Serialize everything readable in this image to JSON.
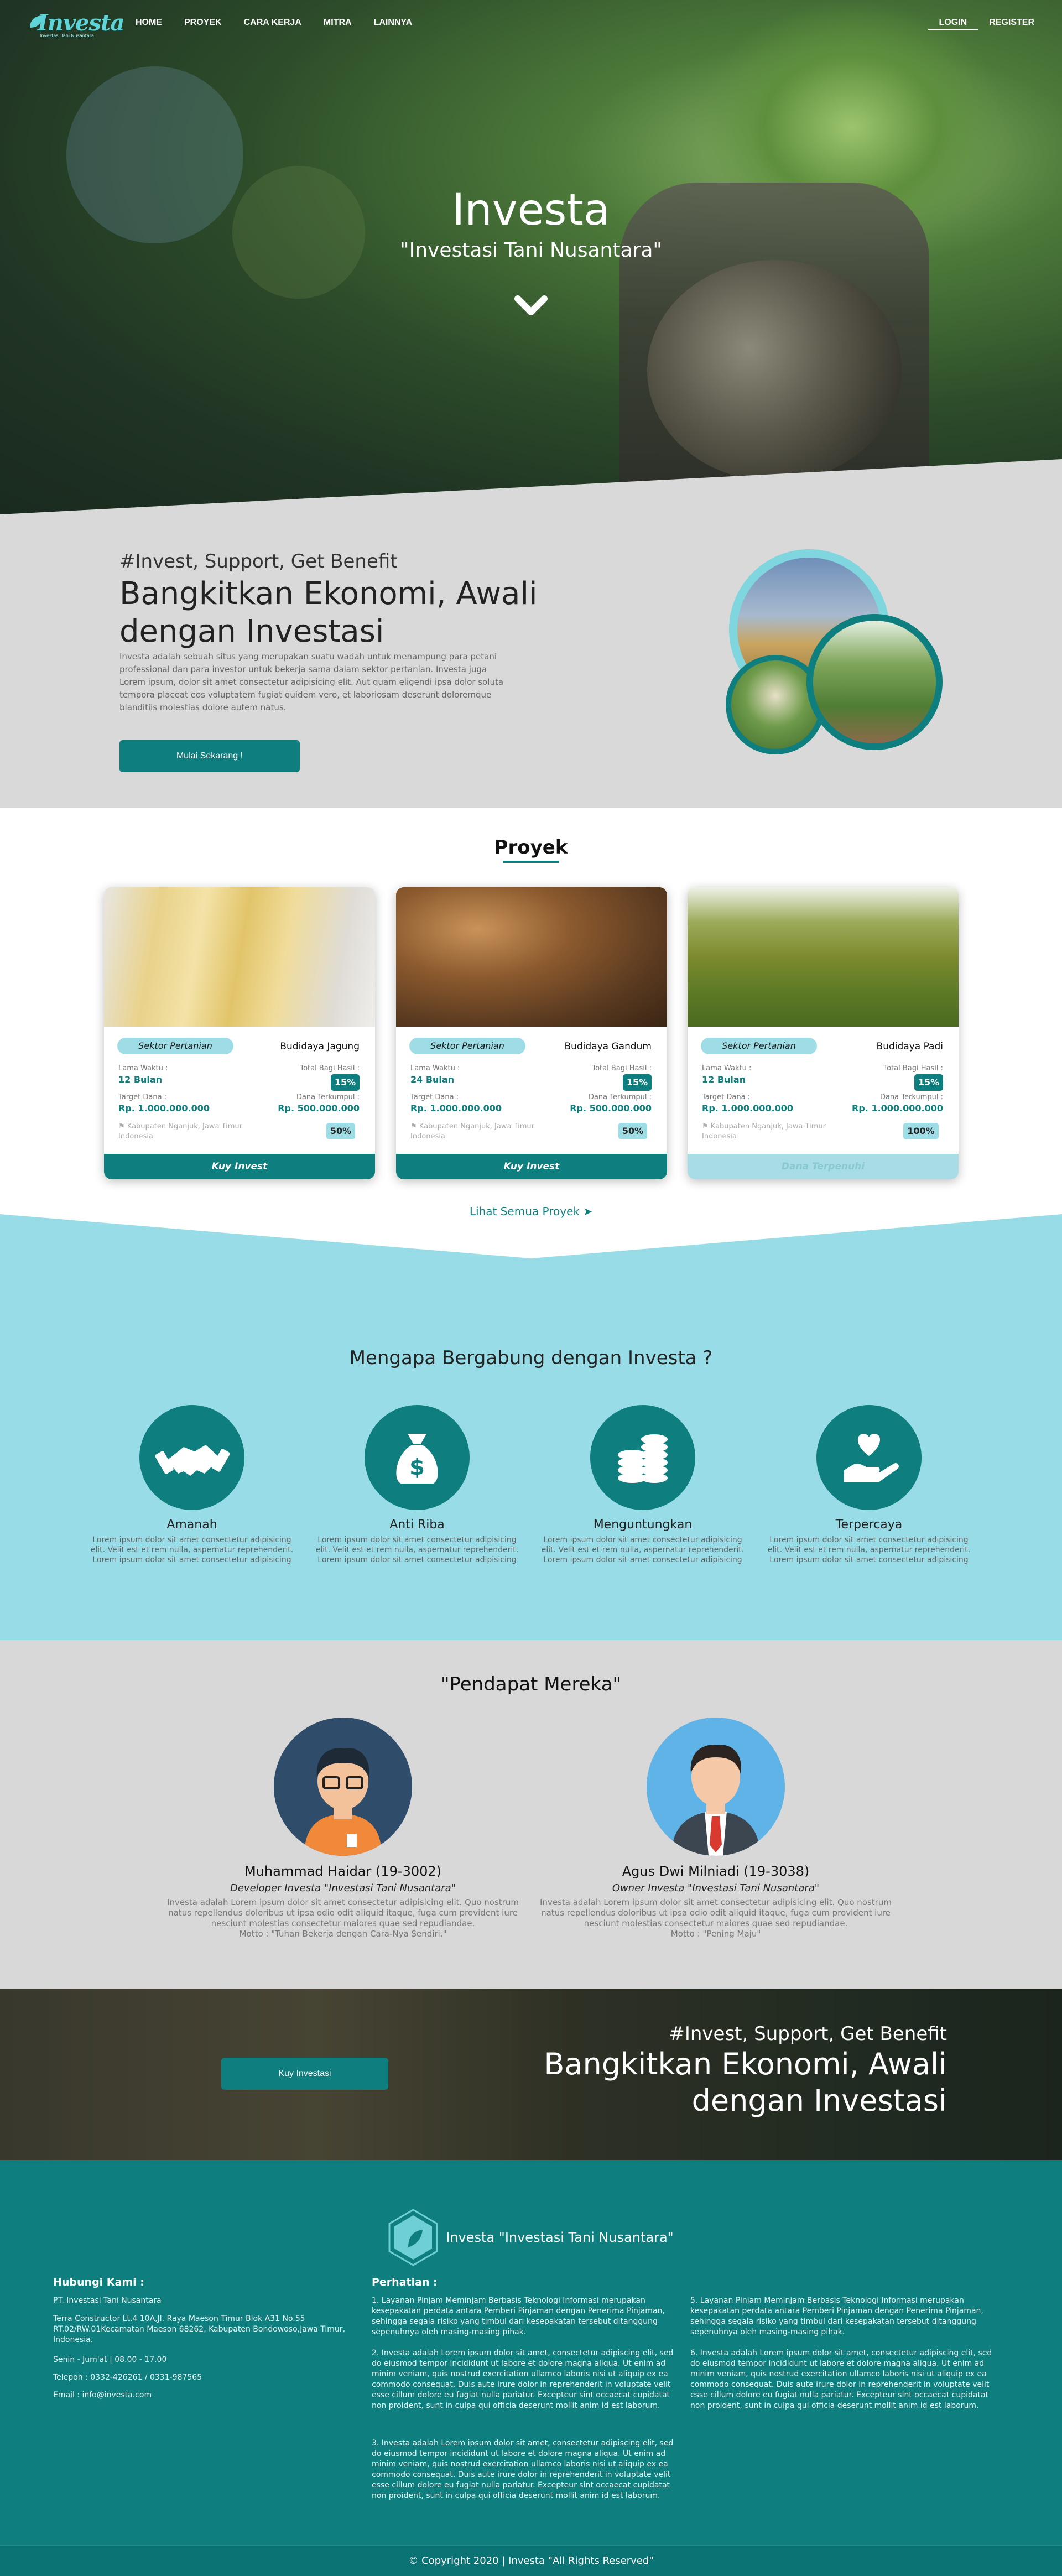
{
  "nav": {
    "logo_text": "Investa",
    "logo_sub": "Investasi Tani Nusantara",
    "links": [
      "HOME",
      "PROYEK",
      "CARA KERJA",
      "MITRA",
      "LAINNYA"
    ],
    "login": "LOGIN",
    "register": "REGISTER"
  },
  "hero": {
    "title": "Investa",
    "tagline": "\"Investasi Tani Nusantara\""
  },
  "about": {
    "hashtag": "#Invest, Support, Get Benefit",
    "heading": "Bangkitkan Ekonomi, Awali dengan Investasi",
    "body": "Investa adalah sebuah situs yang merupakan suatu wadah untuk menampung para petani professional dan para investor untuk bekerja sama dalam sektor pertanian. Investa juga Lorem ipsum, dolor sit amet consectetur adipisicing elit. Aut quam eligendi ipsa dolor soluta tempora placeat eos voluptatem fugiat quidem vero, et laboriosam deserunt doloremque blanditiis molestias dolore autem natus.",
    "cta": "Mulai Sekarang !"
  },
  "projects": {
    "title": "Proyek",
    "cards": [
      {
        "sector": "Sektor Pertanian",
        "name": "Budidaya Jagung",
        "lama_label": "Lama Waktu :",
        "lama": "12 Bulan",
        "bagi_label": "Total Bagi Hasil :",
        "bagi": "15%",
        "target_label": "Target Dana :",
        "target": "Rp. 1.000.000.000",
        "terkumpul_label": "Dana Terkumpul :",
        "terkumpul": "Rp. 500.000.000",
        "progress": "50%",
        "location": "Kabupaten Nganjuk, Jawa Timur Indonesia",
        "button": "Kuy Invest"
      },
      {
        "sector": "Sektor Pertanian",
        "name": "Budidaya Gandum",
        "lama_label": "Lama Waktu :",
        "lama": "24 Bulan",
        "bagi_label": "Total Bagi Hasil :",
        "bagi": "15%",
        "target_label": "Target Dana :",
        "target": "Rp. 1.000.000.000",
        "terkumpul_label": "Dana Terkumpul :",
        "terkumpul": "Rp. 500.000.000",
        "progress": "50%",
        "location": "Kabupaten Nganjuk, Jawa Timur Indonesia",
        "button": "Kuy Invest"
      },
      {
        "sector": "Sektor Pertanian",
        "name": "Budidaya Padi",
        "lama_label": "Lama Waktu :",
        "lama": "12 Bulan",
        "bagi_label": "Total Bagi Hasil :",
        "bagi": "15%",
        "target_label": "Target Dana :",
        "target": "Rp. 1.000.000.000",
        "terkumpul_label": "Dana Terkumpul :",
        "terkumpul": "Rp. 1.000.000.000",
        "progress": "100%",
        "location": "Kabupaten Nganjuk, Jawa Timur Indonesia",
        "button": "Dana Terpenuhi"
      }
    ],
    "all_link": "Lihat Semua Proyek"
  },
  "why": {
    "title": "Mengapa Bergabung dengan Investa ?",
    "features": [
      {
        "icon": "handshake-icon",
        "title": "Amanah",
        "desc": "Lorem ipsum dolor sit amet consectetur adipisicing elit. Velit est et rem nulla, aspernatur reprehenderit. Lorem ipsum dolor sit amet consectetur adipisicing"
      },
      {
        "icon": "money-bag-icon",
        "title": "Anti Riba",
        "desc": "Lorem ipsum dolor sit amet consectetur adipisicing elit. Velit est et rem nulla, aspernatur reprehenderit. Lorem ipsum dolor sit amet consectetur adipisicing"
      },
      {
        "icon": "coins-icon",
        "title": "Menguntungkan",
        "desc": "Lorem ipsum dolor sit amet consectetur adipisicing elit. Velit est et rem nulla, aspernatur reprehenderit. Lorem ipsum dolor sit amet consectetur adipisicing"
      },
      {
        "icon": "heart-hand-icon",
        "title": "Terpercaya",
        "desc": "Lorem ipsum dolor sit amet consectetur adipisicing elit. Velit est et rem nulla, aspernatur reprehenderit. Lorem ipsum dolor sit amet consectetur adipisicing"
      }
    ]
  },
  "testimonials": {
    "title": "\"Pendapat Mereka\"",
    "people": [
      {
        "name": "Muhammad Haidar (19-3002)",
        "role": "Developer Investa \"Investasi Tani Nusantara\"",
        "text": "Investa adalah Lorem ipsum dolor sit amet consectetur adipisicing elit. Quo nostrum natus repellendus doloribus ut ipsa odio odit aliquid itaque, fuga cum provident iure nesciunt molestias consectetur maiores quae sed repudiandae.",
        "motto": "Motto : \"Tuhan Bekerja dengan Cara-Nya Sendiri.\""
      },
      {
        "name": "Agus Dwi Milniadi (19-3038)",
        "role": "Owner Investa \"Investasi Tani Nusantara\"",
        "text": "Investa adalah Lorem ipsum dolor sit amet consectetur adipisicing elit. Quo nostrum natus repellendus doloribus ut ipsa odio odit aliquid itaque, fuga cum provident iure nesciunt molestias consectetur maiores quae sed repudiandae.",
        "motto": "Motto : \"Pening Maju\""
      }
    ]
  },
  "banner": {
    "hashtag": "#Invest, Support, Get Benefit",
    "heading": "Bangkitkan Ekonomi, Awali dengan Investasi",
    "cta": "Kuy Investasi"
  },
  "footer": {
    "brand": "Investa \"Investasi Tani Nusantara\"",
    "contact_title": "Hubungi Kami :",
    "company": "PT. Investasi Tani Nusantara",
    "address": "Terra Constructor Lt.4 10A,Jl. Raya Maeson Timur Blok A31 No.55 RT.02/RW.01Kecamatan Maeson 68262, Kabupaten Bondowoso,Jawa Timur, Indonesia.",
    "hours": "Senin - Jum'at | 08.00 - 17.00",
    "phone": "Telepon : 0332-426261 / 0331-987565",
    "email": "Email : info@investa.com",
    "notice_title": "Perhatian :",
    "notices": [
      "1. Layanan Pinjam Meminjam Berbasis Teknologi Informasi merupakan kesepakatan perdata antara Pemberi Pinjaman dengan Penerima Pinjaman, sehingga segala risiko yang timbul dari kesepakatan tersebut ditanggung sepenuhnya oleh masing-masing pihak.",
      "2. Investa adalah Lorem ipsum dolor sit amet, consectetur adipiscing elit, sed do eiusmod tempor incididunt ut labore et dolore magna aliqua. Ut enim ad minim veniam, quis nostrud exercitation ullamco laboris nisi ut aliquip ex ea commodo consequat. Duis aute irure dolor in reprehenderit in voluptate velit esse cillum dolore eu fugiat nulla pariatur. Excepteur sint occaecat cupidatat non proident, sunt in culpa qui officia deserunt mollit anim id est laborum.",
      "3. Investa adalah Lorem ipsum dolor sit amet, consectetur adipiscing elit, sed do eiusmod tempor incididunt ut labore et dolore magna aliqua. Ut enim ad minim veniam, quis nostrud exercitation ullamco laboris nisi ut aliquip ex ea commodo consequat. Duis aute irure dolor in reprehenderit in voluptate velit esse cillum dolore eu fugiat nulla pariatur. Excepteur sint occaecat cupidatat non proident, sunt in culpa qui officia deserunt mollit anim id est laborum.",
      "5. Layanan Pinjam Meminjam Berbasis Teknologi Informasi merupakan kesepakatan perdata antara Pemberi Pinjaman dengan Penerima Pinjaman, sehingga segala risiko yang timbul dari kesepakatan tersebut ditanggung sepenuhnya oleh masing-masing pihak.",
      "6. Investa adalah Lorem ipsum dolor sit amet, consectetur adipiscing elit, sed do eiusmod tempor incididunt ut labore et dolore magna aliqua. Ut enim ad minim veniam, quis nostrud exercitation ullamco laboris nisi ut aliquip ex ea commodo consequat. Duis aute irure dolor in reprehenderit in voluptate velit esse cillum dolore eu fugiat nulla pariatur. Excepteur sint occaecat cupidatat non proident, sunt in culpa qui officia deserunt mollit anim id est laborum."
    ],
    "copyright": "© Copyright 2020 | Investa \"All Rights Reserved\""
  },
  "colors": {
    "teal": "#0e7e7e",
    "light_teal": "#97dce6",
    "gray": "#d9d9d9"
  }
}
